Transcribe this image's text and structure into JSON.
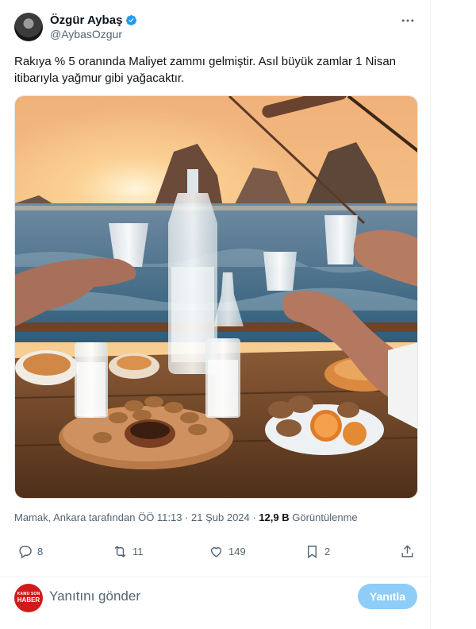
{
  "tweet": {
    "author": {
      "display_name": "Özgür Aybaş",
      "handle": "@AybasOzgur",
      "verified": true,
      "avatar_icon": "avatar"
    },
    "more_icon": "more-dots-icon",
    "text": "Rakıya % 5 oranında Maliyet zammı gelmiştir. Asıl büyük zamlar 1 Nisan itibarıyla yağmur gibi yağacaktır.",
    "image_alt": "Rakı glasses raised at sunset on a boat with meze plates",
    "meta": {
      "location_time": "Mamak, Ankara tarafından ÖÖ 11:13 · 21 Şub 2024 · ",
      "views_count": "12,9 B",
      "views_label": " Görüntülenme"
    },
    "actions": {
      "replies": "8",
      "retweets": "11",
      "likes": "149",
      "bookmarks": "2"
    }
  },
  "reply_bar": {
    "logo_line1": "KAMU SON",
    "logo_line2": "HABER",
    "placeholder": "Yanıtını gönder",
    "button_label": "Yanıtla"
  },
  "colors": {
    "accent": "#1d9bf0",
    "accent_disabled": "#8ecdf8",
    "secondary_text": "#536471",
    "logo_red": "#d11a1a"
  }
}
